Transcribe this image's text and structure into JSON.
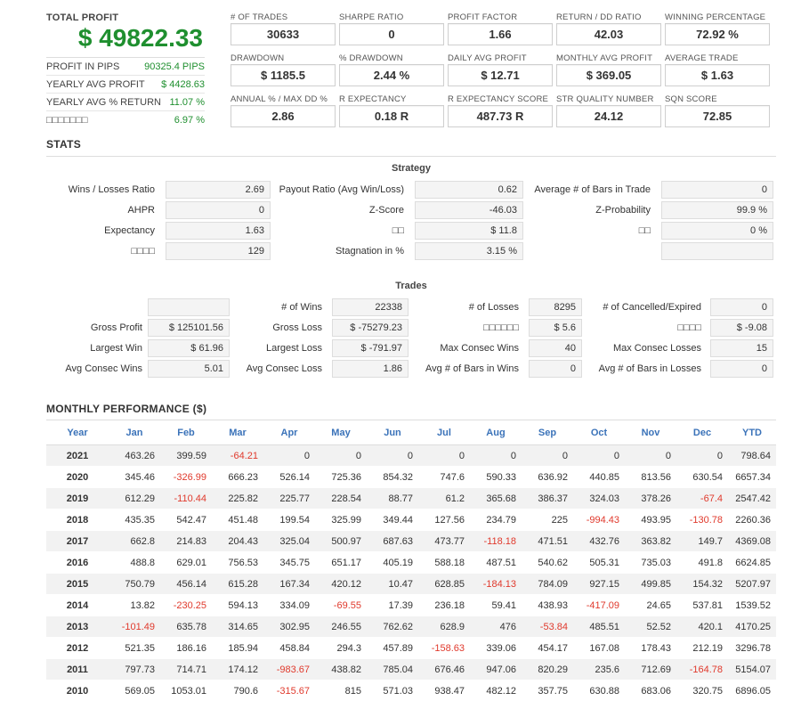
{
  "summary": {
    "total_profit_label": "TOTAL PROFIT",
    "total_profit_value": "$ 49822.33",
    "rows": [
      {
        "label": "PROFIT IN PIPS",
        "value": "90325.4 PIPS"
      },
      {
        "label": "YEARLY AVG PROFIT",
        "value": "$ 4428.63"
      },
      {
        "label": "YEARLY AVG % RETURN",
        "value": "11.07 %"
      },
      {
        "label": "□□□□□□□",
        "value": "6.97 %"
      }
    ]
  },
  "metrics": [
    {
      "label": "# OF TRADES",
      "value": "30633"
    },
    {
      "label": "SHARPE RATIO",
      "value": "0"
    },
    {
      "label": "PROFIT FACTOR",
      "value": "1.66"
    },
    {
      "label": "RETURN / DD RATIO",
      "value": "42.03"
    },
    {
      "label": "WINNING PERCENTAGE",
      "value": "72.92 %"
    },
    {
      "label": "DRAWDOWN",
      "value": "$ 1185.5"
    },
    {
      "label": "% DRAWDOWN",
      "value": "2.44 %"
    },
    {
      "label": "DAILY AVG PROFIT",
      "value": "$ 12.71"
    },
    {
      "label": "MONTHLY AVG PROFIT",
      "value": "$ 369.05"
    },
    {
      "label": "AVERAGE TRADE",
      "value": "$ 1.63"
    },
    {
      "label": "ANNUAL % / MAX DD %",
      "value": "2.86"
    },
    {
      "label": "R EXPECTANCY",
      "value": "0.18 R"
    },
    {
      "label": "R EXPECTANCY SCORE",
      "value": "487.73 R"
    },
    {
      "label": "STR QUALITY NUMBER",
      "value": "24.12"
    },
    {
      "label": "SQN SCORE",
      "value": "72.85"
    }
  ],
  "stats": {
    "title": "STATS",
    "strategy_title": "Strategy",
    "strategy": [
      {
        "label": "Wins / Losses Ratio",
        "value": "2.69"
      },
      {
        "label": "Payout Ratio (Avg Win/Loss)",
        "value": "0.62"
      },
      {
        "label": "Average # of Bars in Trade",
        "value": "0"
      },
      {
        "label": "AHPR",
        "value": "0"
      },
      {
        "label": "Z-Score",
        "value": "-46.03"
      },
      {
        "label": "Z-Probability",
        "value": "99.9 %"
      },
      {
        "label": "Expectancy",
        "value": "1.63"
      },
      {
        "label": "□□",
        "value": "$ 11.8"
      },
      {
        "label": "□□",
        "value": "0 %"
      },
      {
        "label": "□□□□",
        "value": "129"
      },
      {
        "label": "Stagnation in %",
        "value": "3.15 %"
      },
      {
        "label": "",
        "value": ""
      }
    ],
    "trades_title": "Trades",
    "trades": [
      {
        "label": "",
        "value": ""
      },
      {
        "label": "# of Wins",
        "value": "22338"
      },
      {
        "label": "# of Losses",
        "value": "8295"
      },
      {
        "label": "# of Cancelled/Expired",
        "value": "0"
      },
      {
        "label": "Gross Profit",
        "value": "$ 125101.56"
      },
      {
        "label": "Gross Loss",
        "value": "$ -75279.23"
      },
      {
        "label": "□□□□□□",
        "value": "$ 5.6"
      },
      {
        "label": "□□□□",
        "value": "$ -9.08"
      },
      {
        "label": "Largest Win",
        "value": "$ 61.96"
      },
      {
        "label": "Largest Loss",
        "value": "$ -791.97"
      },
      {
        "label": "Max Consec Wins",
        "value": "40"
      },
      {
        "label": "Max Consec Losses",
        "value": "15"
      },
      {
        "label": "Avg Consec Wins",
        "value": "5.01"
      },
      {
        "label": "Avg Consec Loss",
        "value": "1.86"
      },
      {
        "label": "Avg # of Bars in Wins",
        "value": "0"
      },
      {
        "label": "Avg # of Bars in Losses",
        "value": "0"
      }
    ]
  },
  "monthly": {
    "title": "MONTHLY PERFORMANCE ($)",
    "headers": [
      "Year",
      "Jan",
      "Feb",
      "Mar",
      "Apr",
      "May",
      "Jun",
      "Jul",
      "Aug",
      "Sep",
      "Oct",
      "Nov",
      "Dec",
      "YTD"
    ],
    "rows": [
      [
        "2021",
        "463.26",
        "399.59",
        "-64.21",
        "0",
        "0",
        "0",
        "0",
        "0",
        "0",
        "0",
        "0",
        "0",
        "798.64"
      ],
      [
        "2020",
        "345.46",
        "-326.99",
        "666.23",
        "526.14",
        "725.36",
        "854.32",
        "747.6",
        "590.33",
        "636.92",
        "440.85",
        "813.56",
        "630.54",
        "6657.34"
      ],
      [
        "2019",
        "612.29",
        "-110.44",
        "225.82",
        "225.77",
        "228.54",
        "88.77",
        "61.2",
        "365.68",
        "386.37",
        "324.03",
        "378.26",
        "-67.4",
        "2547.42"
      ],
      [
        "2018",
        "435.35",
        "542.47",
        "451.48",
        "199.54",
        "325.99",
        "349.44",
        "127.56",
        "234.79",
        "225",
        "-994.43",
        "493.95",
        "-130.78",
        "2260.36"
      ],
      [
        "2017",
        "662.8",
        "214.83",
        "204.43",
        "325.04",
        "500.97",
        "687.63",
        "473.77",
        "-118.18",
        "471.51",
        "432.76",
        "363.82",
        "149.7",
        "4369.08"
      ],
      [
        "2016",
        "488.8",
        "629.01",
        "756.53",
        "345.75",
        "651.17",
        "405.19",
        "588.18",
        "487.51",
        "540.62",
        "505.31",
        "735.03",
        "491.8",
        "6624.85"
      ],
      [
        "2015",
        "750.79",
        "456.14",
        "615.28",
        "167.34",
        "420.12",
        "10.47",
        "628.85",
        "-184.13",
        "784.09",
        "927.15",
        "499.85",
        "154.32",
        "5207.97"
      ],
      [
        "2014",
        "13.82",
        "-230.25",
        "594.13",
        "334.09",
        "-69.55",
        "17.39",
        "236.18",
        "59.41",
        "438.93",
        "-417.09",
        "24.65",
        "537.81",
        "1539.52"
      ],
      [
        "2013",
        "-101.49",
        "635.78",
        "314.65",
        "302.95",
        "246.55",
        "762.62",
        "628.9",
        "476",
        "-53.84",
        "485.51",
        "52.52",
        "420.1",
        "4170.25"
      ],
      [
        "2012",
        "521.35",
        "186.16",
        "185.94",
        "458.84",
        "294.3",
        "457.89",
        "-158.63",
        "339.06",
        "454.17",
        "167.08",
        "178.43",
        "212.19",
        "3296.78"
      ],
      [
        "2011",
        "797.73",
        "714.71",
        "174.12",
        "-983.67",
        "438.82",
        "785.04",
        "676.46",
        "947.06",
        "820.29",
        "235.6",
        "712.69",
        "-164.78",
        "5154.07"
      ],
      [
        "2010",
        "569.05",
        "1053.01",
        "790.6",
        "-315.67",
        "815",
        "571.03",
        "938.47",
        "482.12",
        "357.75",
        "630.88",
        "683.06",
        "320.75",
        "6896.05"
      ]
    ]
  },
  "colors": {
    "profit_green": "#1f8f2f",
    "negative_red": "#e0392c",
    "header_blue": "#3b73b9"
  }
}
